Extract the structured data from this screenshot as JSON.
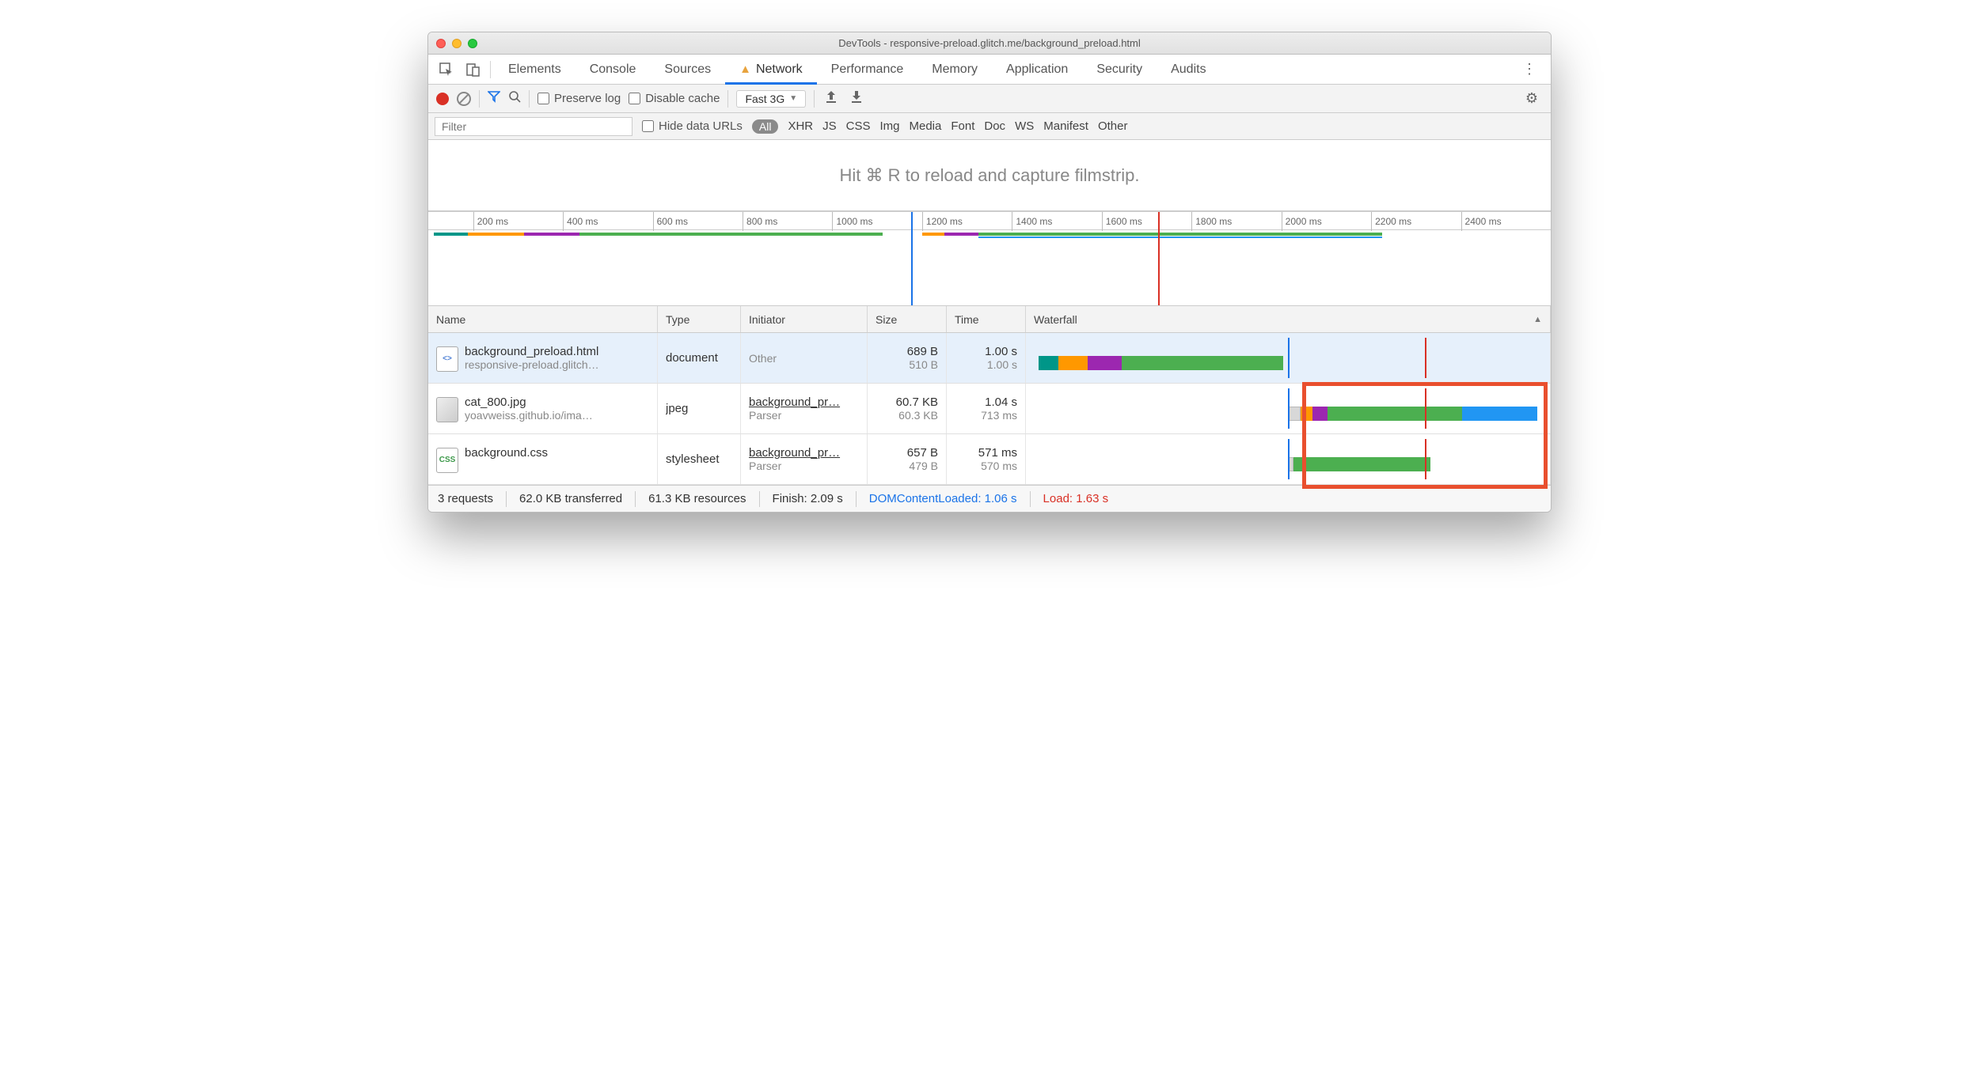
{
  "window_title": "DevTools - responsive-preload.glitch.me/background_preload.html",
  "main_tabs": {
    "elements": "Elements",
    "console": "Console",
    "sources": "Sources",
    "network": "Network",
    "performance": "Performance",
    "memory": "Memory",
    "application": "Application",
    "security": "Security",
    "audits": "Audits"
  },
  "toolbar": {
    "preserve_log": "Preserve log",
    "disable_cache": "Disable cache",
    "throttle": "Fast 3G"
  },
  "filter": {
    "placeholder": "Filter",
    "hide_urls": "Hide data URLs",
    "types": {
      "all": "All",
      "xhr": "XHR",
      "js": "JS",
      "css": "CSS",
      "img": "Img",
      "media": "Media",
      "font": "Font",
      "doc": "Doc",
      "ws": "WS",
      "manifest": "Manifest",
      "other": "Other"
    }
  },
  "filmstrip_hint": "Hit ⌘ R to reload and capture filmstrip.",
  "ruler_ticks": [
    "200 ms",
    "400 ms",
    "600 ms",
    "800 ms",
    "1000 ms",
    "1200 ms",
    "1400 ms",
    "1600 ms",
    "1800 ms",
    "2000 ms",
    "2200 ms",
    "2400 ms"
  ],
  "columns": {
    "name": "Name",
    "type": "Type",
    "initiator": "Initiator",
    "size": "Size",
    "time": "Time",
    "waterfall": "Waterfall"
  },
  "rows": [
    {
      "name": "background_preload.html",
      "sub": "responsive-preload.glitch…",
      "type": "document",
      "initiator": "Other",
      "initiator_sub": "",
      "size": "689 B",
      "size2": "510 B",
      "time": "1.00 s",
      "time2": "1.00 s"
    },
    {
      "name": "cat_800.jpg",
      "sub": "yoavweiss.github.io/ima…",
      "type": "jpeg",
      "initiator": "background_pr…",
      "initiator_sub": "Parser",
      "size": "60.7 KB",
      "size2": "60.3 KB",
      "time": "1.04 s",
      "time2": "713 ms"
    },
    {
      "name": "background.css",
      "sub": "",
      "type": "stylesheet",
      "initiator": "background_pr…",
      "initiator_sub": "Parser",
      "size": "657 B",
      "size2": "479 B",
      "time": "571 ms",
      "time2": "570 ms"
    }
  ],
  "footer": {
    "requests": "3 requests",
    "transferred": "62.0 KB transferred",
    "resources": "61.3 KB resources",
    "finish": "Finish: 2.09 s",
    "dcl": "DOMContentLoaded: 1.06 s",
    "load": "Load: 1.63 s"
  }
}
